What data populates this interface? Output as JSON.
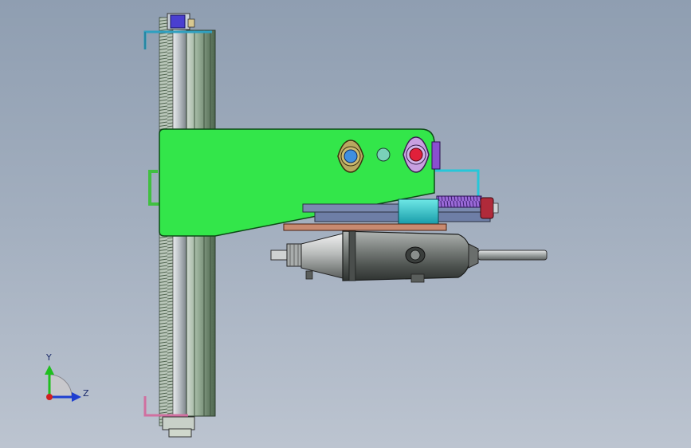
{
  "viewport": {
    "background_top": "#8f9eb1",
    "background_bottom": "#bcc4d0"
  },
  "triad": {
    "y_label": "Y",
    "z_label": "Z",
    "y_color": "#1fbf1f",
    "z_color": "#1f3fd0",
    "origin_color": "#d01f1f"
  },
  "model": {
    "bracket_color": "#33e64a",
    "rail_color": "#8aa08a",
    "tool_body_color": "#7a7f7c",
    "hole_blue": "#3f8fe0",
    "hole_red": "#e0203a",
    "accent_cyan": "#26c7d9",
    "accent_purple": "#8a4fd0"
  }
}
